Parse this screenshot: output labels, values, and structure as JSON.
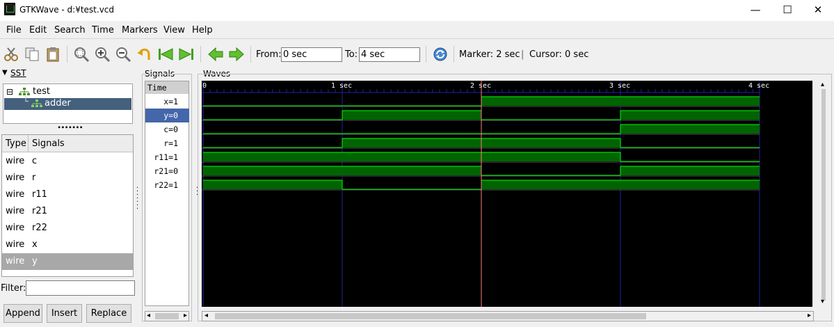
{
  "window": {
    "title": "GTKWave - d:¥test.vcd",
    "minimize": "—",
    "maximize": "☐",
    "close": "✕"
  },
  "menu": [
    "File",
    "Edit",
    "Search",
    "Time",
    "Markers",
    "View",
    "Help"
  ],
  "toolbar": {
    "icons": [
      "cut-icon",
      "copy-icon",
      "paste-icon",
      "zoom-fit-icon",
      "zoom-in-icon",
      "zoom-out-icon",
      "undo-zoom-icon",
      "zoom-start-icon",
      "zoom-end-icon",
      "left-arrow-icon",
      "right-arrow-icon"
    ],
    "from_label": "From:",
    "from_value": "0 sec",
    "to_label": "To:",
    "to_value": "4 sec",
    "reload_icon": "reload-icon",
    "marker_text": "Marker: 2 sec",
    "separator": "|",
    "cursor_text": "Cursor: 0 sec"
  },
  "sst": {
    "title": "SST",
    "tree": [
      {
        "label": "test",
        "expander": "⊟"
      },
      {
        "label": "adder"
      }
    ],
    "grip": "∙∙∙∙∙∙∙",
    "col_type": "Type",
    "col_signals": "Signals",
    "rows": [
      {
        "type": "wire",
        "name": "c"
      },
      {
        "type": "wire",
        "name": "r"
      },
      {
        "type": "wire",
        "name": "r11"
      },
      {
        "type": "wire",
        "name": "r21"
      },
      {
        "type": "wire",
        "name": "r22"
      },
      {
        "type": "wire",
        "name": "x"
      },
      {
        "type": "wire",
        "name": "y"
      }
    ],
    "filter_label": "Filter:",
    "filter_value": "",
    "buttons": {
      "append": "Append",
      "insert": "Insert",
      "replace": "Replace"
    }
  },
  "signals": {
    "title": "Signals",
    "header": "Time",
    "rows": [
      "x=1",
      "y=0",
      "c=0",
      "r=1",
      "r11=1",
      "r21=0",
      "r22=1"
    ]
  },
  "waves": {
    "title": "Waves",
    "time_labels": [
      "0",
      "1 sec",
      "2 sec",
      "3 sec",
      "4 sec"
    ],
    "time_start": 0,
    "time_end": 4,
    "marker_time": 2,
    "signals": [
      {
        "name": "x",
        "transitions": [
          [
            0,
            0
          ],
          [
            2,
            1
          ]
        ]
      },
      {
        "name": "y",
        "transitions": [
          [
            0,
            0
          ],
          [
            1,
            1
          ],
          [
            2,
            0
          ],
          [
            3,
            1
          ]
        ]
      },
      {
        "name": "c",
        "transitions": [
          [
            0,
            0
          ],
          [
            3,
            1
          ]
        ]
      },
      {
        "name": "r",
        "transitions": [
          [
            0,
            0
          ],
          [
            1,
            1
          ],
          [
            3,
            0
          ]
        ]
      },
      {
        "name": "r11",
        "transitions": [
          [
            0,
            1
          ],
          [
            3,
            0
          ]
        ]
      },
      {
        "name": "r21",
        "transitions": [
          [
            0,
            1
          ],
          [
            2,
            0
          ],
          [
            3,
            1
          ]
        ]
      },
      {
        "name": "r22",
        "transitions": [
          [
            0,
            1
          ],
          [
            1,
            0
          ],
          [
            2,
            1
          ]
        ]
      }
    ],
    "colors": {
      "background": "#000000",
      "wave_high": "#006400",
      "wave_line": "#00ff00",
      "grid": "#2020a0",
      "marker": "#ff8080"
    }
  },
  "scroll": {
    "left": "◂",
    "right": "▸",
    "up": "▴",
    "down": "▾"
  }
}
